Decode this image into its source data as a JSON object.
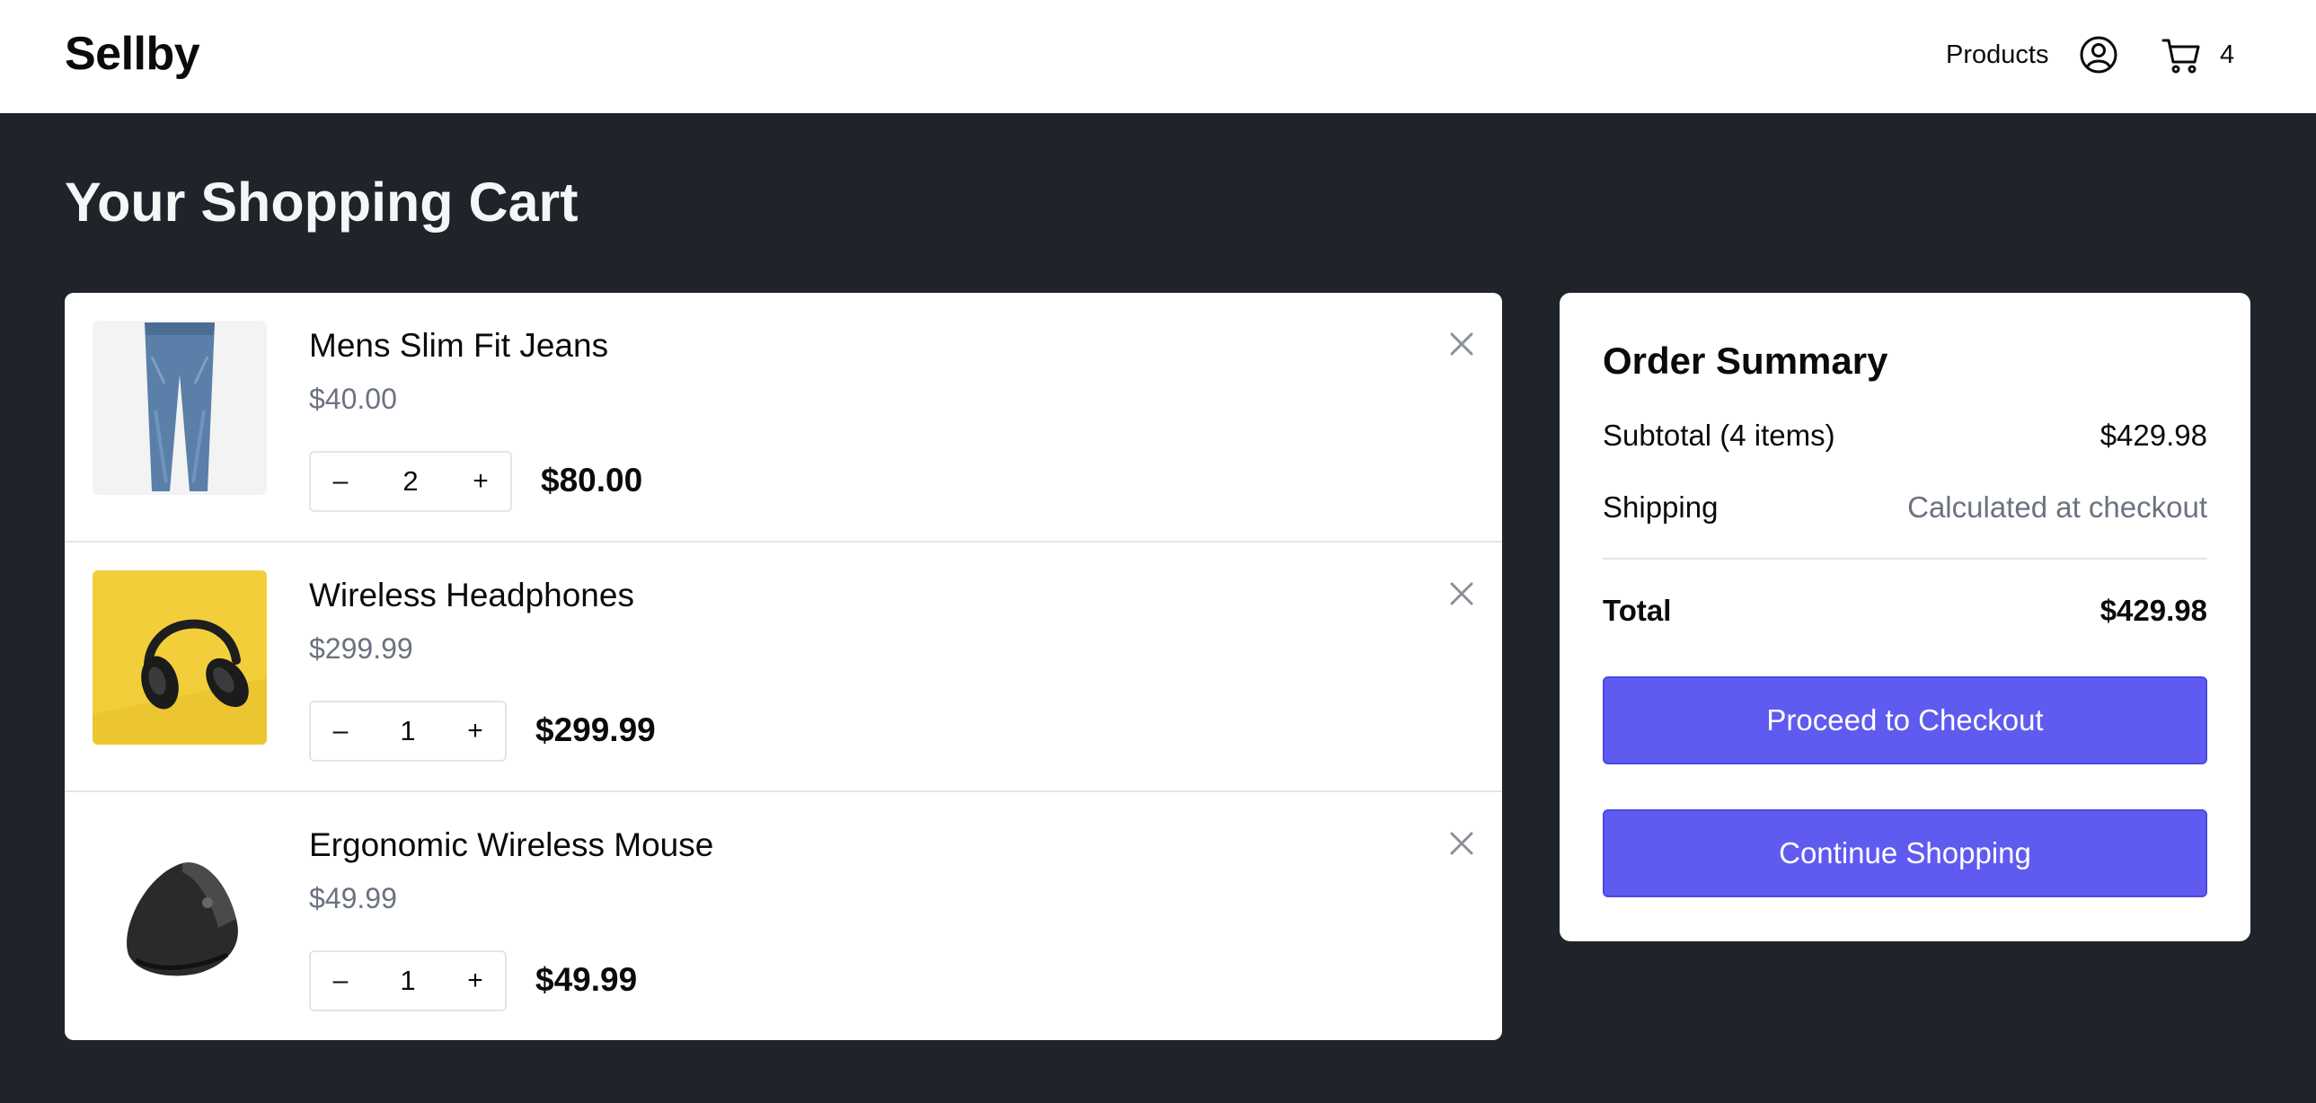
{
  "header": {
    "logo": "Sellby",
    "nav_products": "Products",
    "cart_count": "4"
  },
  "page_title": "Your Shopping Cart",
  "cart": {
    "items": [
      {
        "name": "Mens Slim Fit Jeans",
        "unit_price": "$40.00",
        "quantity": "2",
        "line_total": "$80.00",
        "decrease_label": "–",
        "increase_label": "+",
        "image": "jeans-image"
      },
      {
        "name": "Wireless Headphones",
        "unit_price": "$299.99",
        "quantity": "1",
        "line_total": "$299.99",
        "decrease_label": "–",
        "increase_label": "+",
        "image": "headphones-image"
      },
      {
        "name": "Ergonomic Wireless Mouse",
        "unit_price": "$49.99",
        "quantity": "1",
        "line_total": "$49.99",
        "decrease_label": "–",
        "increase_label": "+",
        "image": "mouse-image"
      }
    ]
  },
  "summary": {
    "title": "Order Summary",
    "subtotal_label": "Subtotal (4 items)",
    "subtotal_value": "$429.98",
    "shipping_label": "Shipping",
    "shipping_value": "Calculated at checkout",
    "total_label": "Total",
    "total_value": "$429.98",
    "checkout_label": "Proceed to Checkout",
    "continue_label": "Continue Shopping"
  },
  "colors": {
    "background": "#1f232a",
    "accent": "#5f5bf0",
    "muted_text": "#6b7280"
  }
}
